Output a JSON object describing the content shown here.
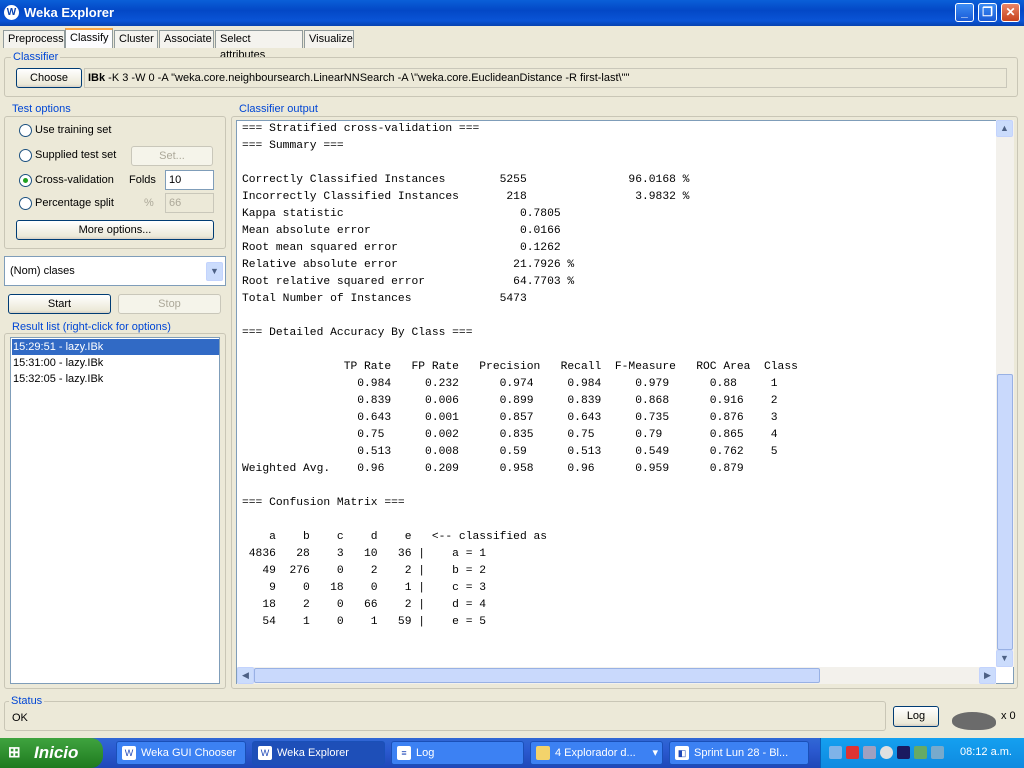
{
  "window": {
    "title": "Weka Explorer"
  },
  "tabs": [
    "Preprocess",
    "Classify",
    "Cluster",
    "Associate",
    "Select attributes",
    "Visualize"
  ],
  "classifier": {
    "group_label": "Classifier",
    "choose_label": "Choose",
    "name": "IBk",
    "options": " -K 3 -W 0 -A \"weka.core.neighboursearch.LinearNNSearch -A \\\"weka.core.EuclideanDistance -R first-last\\\"\""
  },
  "test_options": {
    "group_label": "Test options",
    "use_training": "Use training set",
    "supplied_test": "Supplied test set",
    "set_label": "Set...",
    "cross_validation": "Cross-validation",
    "folds_label": "Folds",
    "folds_value": "10",
    "percentage_split": "Percentage split",
    "percent_symbol": "%",
    "percent_value": "66",
    "more_options": "More options..."
  },
  "class_select": {
    "value": "(Nom) clases"
  },
  "run": {
    "start_label": "Start",
    "stop_label": "Stop"
  },
  "result_list": {
    "label": "Result list (right-click for options)",
    "items": [
      "15:29:51 - lazy.IBk",
      "15:31:00 - lazy.IBk",
      "15:32:05 - lazy.IBk"
    ]
  },
  "output": {
    "label": "Classifier output",
    "text": "=== Stratified cross-validation ===\n=== Summary ===\n\nCorrectly Classified Instances        5255               96.0168 %\nIncorrectly Classified Instances       218                3.9832 %\nKappa statistic                          0.7805\nMean absolute error                      0.0166\nRoot mean squared error                  0.1262\nRelative absolute error                 21.7926 %\nRoot relative squared error             64.7703 %\nTotal Number of Instances             5473\n\n=== Detailed Accuracy By Class ===\n\n               TP Rate   FP Rate   Precision   Recall  F-Measure   ROC Area  Class\n                 0.984     0.232      0.974     0.984     0.979      0.88     1\n                 0.839     0.006      0.899     0.839     0.868      0.916    2\n                 0.643     0.001      0.857     0.643     0.735      0.876    3\n                 0.75      0.002      0.835     0.75      0.79       0.865    4\n                 0.513     0.008      0.59      0.513     0.549      0.762    5\nWeighted Avg.    0.96      0.209      0.958     0.96      0.959      0.879\n\n=== Confusion Matrix ===\n\n    a    b    c    d    e   <-- classified as\n 4836   28    3   10   36 |    a = 1\n   49  276    0    2    2 |    b = 2\n    9    0   18    0    1 |    c = 3\n   18    2    0   66    2 |    d = 4\n   54    1    0    1   59 |    e = 5"
  },
  "status": {
    "label": "Status",
    "text": "OK",
    "log_label": "Log",
    "task_count": "x 0"
  },
  "taskbar": {
    "start_label": "Inicio",
    "tasks": [
      "Weka GUI Chooser",
      "Weka Explorer",
      "Log",
      "4 Explorador d...",
      "Sprint Lun 28 - Bl..."
    ],
    "clock": "08:12 a.m."
  }
}
